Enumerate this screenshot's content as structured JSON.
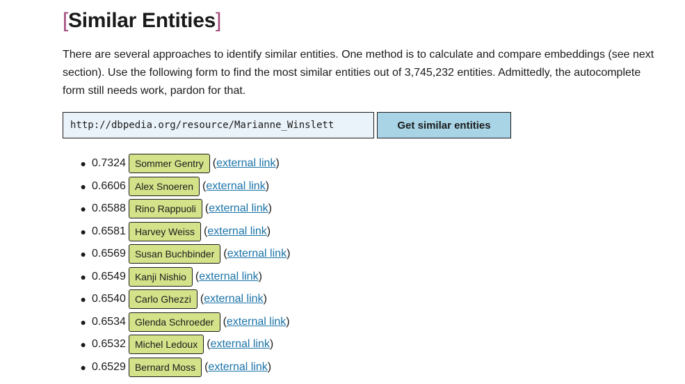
{
  "heading": {
    "open_bracket": "[",
    "text": "Similar Entities",
    "close_bracket": "]"
  },
  "description": "There are several approaches to identify similar entities. One method is to calculate and compare embeddings (see next section). Use the following form to find the most similar entities out of 3,745,232 entities. Admittedly, the autocomplete form still needs work, pardon for that.",
  "form": {
    "url_value": "http://dbpedia.org/resource/Marianne_Winslett",
    "button_label": "Get similar entities"
  },
  "link_label": "external link",
  "results": [
    {
      "score": "0.7324",
      "name": "Sommer Gentry"
    },
    {
      "score": "0.6606",
      "name": "Alex Snoeren"
    },
    {
      "score": "0.6588",
      "name": "Rino Rappuoli"
    },
    {
      "score": "0.6581",
      "name": "Harvey Weiss"
    },
    {
      "score": "0.6569",
      "name": "Susan Buchbinder"
    },
    {
      "score": "0.6549",
      "name": "Kanji Nishio"
    },
    {
      "score": "0.6540",
      "name": "Carlo Ghezzi"
    },
    {
      "score": "0.6534",
      "name": "Glenda Schroeder"
    },
    {
      "score": "0.6532",
      "name": "Michel Ledoux"
    },
    {
      "score": "0.6529",
      "name": "Bernard Moss"
    }
  ],
  "colors": {
    "bracket": "#a0487a",
    "tag_background": "#d4e28a",
    "button_background": "#a8d4e6",
    "input_background": "#eaf3fa",
    "link": "#1a73a8"
  }
}
